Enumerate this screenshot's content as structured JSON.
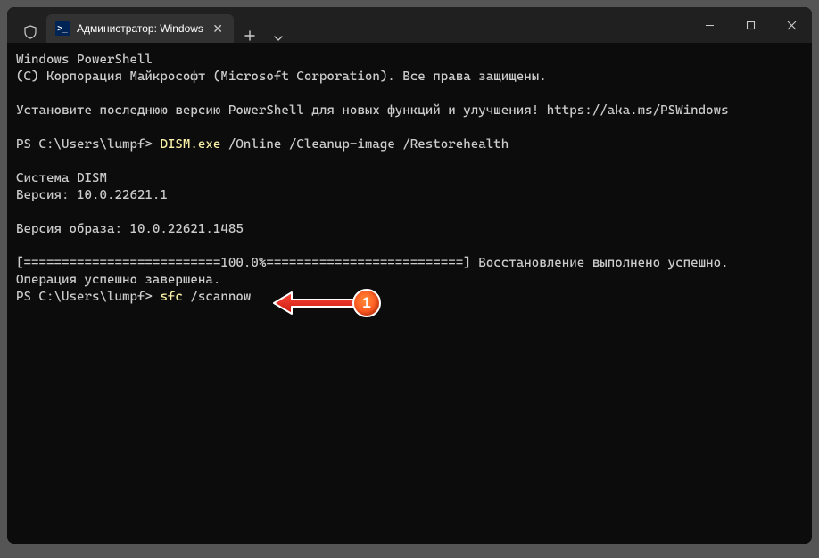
{
  "titlebar": {
    "tab_title": "Администратор: Windows Po",
    "ps_icon_text": ">_"
  },
  "terminal": {
    "line1": "Windows PowerShell",
    "line2": "(C) Корпорация Майкрософт (Microsoft Corporation). Все права защищены.",
    "blank": "",
    "line3": "Установите последнюю версию PowerShell для новых функций и улучшения! https://aka.ms/PSWindows",
    "prompt1_prefix": "PS C:\\Users\\lumpf> ",
    "prompt1_cmd": "DISM.exe",
    "prompt1_args": " /Online /Cleanup-image /Restorehealth",
    "line5": "Cистема DISM",
    "line6": "Версия: 10.0.22621.1",
    "line7": "Версия образа: 10.0.22621.1485",
    "progress": "[==========================100.0%==========================] Восстановление выполнено успешно.",
    "line9": "Операция успешно завершена.",
    "prompt2_prefix": "PS C:\\Users\\lumpf> ",
    "prompt2_cmd": "sfc",
    "prompt2_args": " /scannow"
  },
  "annotation": {
    "badge": "1"
  },
  "colors": {
    "command_yellow": "#f9f1a5",
    "arrow_red": "#e12b1f",
    "badge_bg": "#ff5a1f"
  }
}
